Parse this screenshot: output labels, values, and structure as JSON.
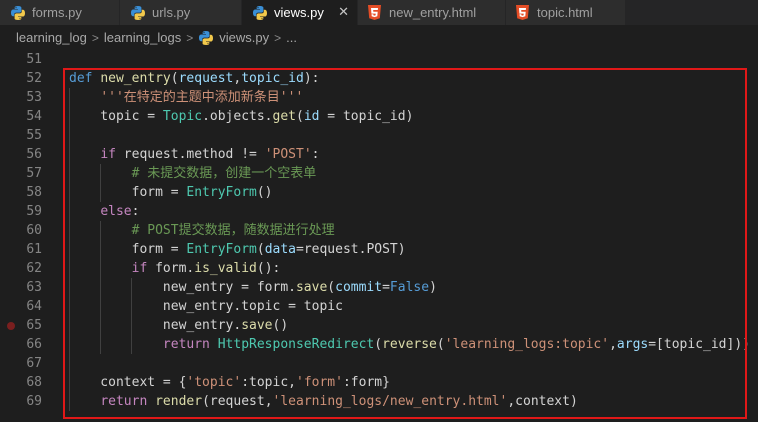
{
  "tabs": [
    {
      "label": "forms.py",
      "icon": "python-icon",
      "active": false
    },
    {
      "label": "urls.py",
      "icon": "python-icon",
      "active": false
    },
    {
      "label": "views.py",
      "icon": "python-icon",
      "active": true
    },
    {
      "label": "new_entry.html",
      "icon": "html5-icon",
      "active": false
    },
    {
      "label": "topic.html",
      "icon": "html5-icon",
      "active": false
    }
  ],
  "tab_close_glyph": "✕",
  "breadcrumb": [
    "learning_log",
    "learning_logs",
    "views.py",
    "..."
  ],
  "breakpoint_line": "65",
  "lines": [
    {
      "n": "51",
      "tokens": []
    },
    {
      "n": "52",
      "tokens": [
        [
          "k",
          "def"
        ],
        [
          "t",
          " "
        ],
        [
          "fn",
          "new_entry"
        ],
        [
          "t",
          "("
        ],
        [
          "pm",
          "request"
        ],
        [
          "t",
          ","
        ],
        [
          "pm",
          "topic_id"
        ],
        [
          "t",
          "):"
        ]
      ]
    },
    {
      "n": "53",
      "tokens": [
        [
          "t",
          "    "
        ],
        [
          "st",
          "'''在特定的主题中添加新条目'''"
        ]
      ]
    },
    {
      "n": "54",
      "tokens": [
        [
          "t",
          "    topic = "
        ],
        [
          "cl",
          "Topic"
        ],
        [
          "t",
          ".objects."
        ],
        [
          "fn",
          "get"
        ],
        [
          "t",
          "("
        ],
        [
          "pm",
          "id"
        ],
        [
          "t",
          " = topic_id)"
        ]
      ]
    },
    {
      "n": "55",
      "tokens": []
    },
    {
      "n": "56",
      "tokens": [
        [
          "t",
          "    "
        ],
        [
          "kc",
          "if"
        ],
        [
          "t",
          " request.method != "
        ],
        [
          "st",
          "'POST'"
        ],
        [
          "t",
          ":"
        ]
      ]
    },
    {
      "n": "57",
      "tokens": [
        [
          "t",
          "        "
        ],
        [
          "cm",
          "# 未提交数据，创建一个空表单"
        ]
      ]
    },
    {
      "n": "58",
      "tokens": [
        [
          "t",
          "        form = "
        ],
        [
          "cl",
          "EntryForm"
        ],
        [
          "t",
          "()"
        ]
      ]
    },
    {
      "n": "59",
      "tokens": [
        [
          "t",
          "    "
        ],
        [
          "kc",
          "else"
        ],
        [
          "t",
          ":"
        ]
      ]
    },
    {
      "n": "60",
      "tokens": [
        [
          "t",
          "        "
        ],
        [
          "cm",
          "# POST提交数据，随数据进行处理"
        ]
      ]
    },
    {
      "n": "61",
      "tokens": [
        [
          "t",
          "        form = "
        ],
        [
          "cl",
          "EntryForm"
        ],
        [
          "t",
          "("
        ],
        [
          "pm",
          "data"
        ],
        [
          "t",
          "=request.POST)"
        ]
      ]
    },
    {
      "n": "62",
      "tokens": [
        [
          "t",
          "        "
        ],
        [
          "kc",
          "if"
        ],
        [
          "t",
          " form."
        ],
        [
          "fn",
          "is_valid"
        ],
        [
          "t",
          "():"
        ]
      ]
    },
    {
      "n": "63",
      "tokens": [
        [
          "t",
          "            new_entry = form."
        ],
        [
          "fn",
          "save"
        ],
        [
          "t",
          "("
        ],
        [
          "pm",
          "commit"
        ],
        [
          "t",
          "="
        ],
        [
          "k",
          "False"
        ],
        [
          "t",
          ")"
        ]
      ]
    },
    {
      "n": "64",
      "tokens": [
        [
          "t",
          "            new_entry.topic = topic"
        ]
      ]
    },
    {
      "n": "65",
      "tokens": [
        [
          "t",
          "            new_entry."
        ],
        [
          "fn",
          "save"
        ],
        [
          "t",
          "()"
        ]
      ]
    },
    {
      "n": "66",
      "tokens": [
        [
          "t",
          "            "
        ],
        [
          "kc",
          "return"
        ],
        [
          "t",
          " "
        ],
        [
          "cl",
          "HttpResponseRedirect"
        ],
        [
          "t",
          "("
        ],
        [
          "fn",
          "reverse"
        ],
        [
          "t",
          "("
        ],
        [
          "st",
          "'learning_logs:topic'"
        ],
        [
          "t",
          ","
        ],
        [
          "pm",
          "args"
        ],
        [
          "t",
          "=[topic_id]))"
        ]
      ]
    },
    {
      "n": "67",
      "tokens": []
    },
    {
      "n": "68",
      "tokens": [
        [
          "t",
          "    context = {"
        ],
        [
          "st",
          "'topic'"
        ],
        [
          "t",
          ":topic,"
        ],
        [
          "st",
          "'form'"
        ],
        [
          "t",
          ":form}"
        ]
      ]
    },
    {
      "n": "69",
      "tokens": [
        [
          "t",
          "    "
        ],
        [
          "kc",
          "return"
        ],
        [
          "t",
          " "
        ],
        [
          "fn",
          "render"
        ],
        [
          "t",
          "(request,"
        ],
        [
          "st",
          "'learning_logs/new_entry.html'"
        ],
        [
          "t",
          ",context)"
        ]
      ]
    }
  ],
  "colors": {
    "background": "#1e1e1e",
    "highlight_box": "#e01818",
    "keyword": "#569cd6",
    "control": "#c586c0",
    "function": "#dcdcaa",
    "parameter": "#9cdcfe",
    "string": "#ce9178",
    "comment": "#6a9955",
    "class": "#4ec9b0"
  }
}
